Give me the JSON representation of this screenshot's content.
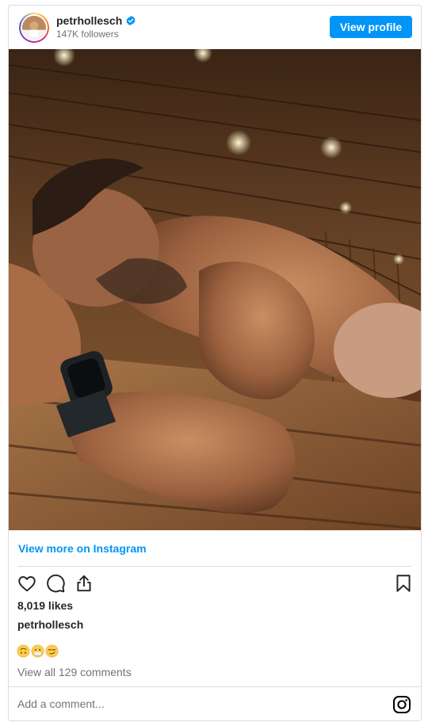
{
  "header": {
    "username": "petrhollesch",
    "followers": "147K followers",
    "view_profile_label": "View profile"
  },
  "icons": {
    "avatar": "profile-photo",
    "verified": "verified-badge-icon",
    "like": "heart-icon",
    "comment": "comment-bubble-icon",
    "share": "share-icon",
    "save": "bookmark-icon",
    "instagram": "instagram-logo-icon"
  },
  "post": {
    "view_more_label": "View more on Instagram",
    "likes": "8,019 likes",
    "caption_username": "petrhollesch",
    "caption_emojis": [
      "upside-down-face",
      "face-with-mouth-covered",
      "smirking-face"
    ],
    "view_comments": "View all 129 comments",
    "comment_placeholder": "Add a comment..."
  },
  "colors": {
    "accent": "#0095f6",
    "text": "#262626",
    "muted": "#737373",
    "border": "#dbdbdb"
  }
}
